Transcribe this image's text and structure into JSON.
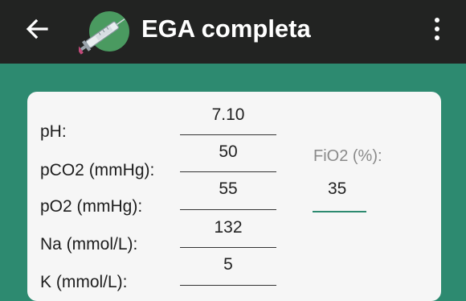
{
  "header": {
    "title": "EGA completa",
    "back_icon": "arrow-left-icon",
    "logo_icon": "syringe-icon",
    "menu_icon": "more-vert-icon"
  },
  "colors": {
    "appbar": "#222322",
    "accent": "#2d8a70",
    "card": "#f6f6f6"
  },
  "form": {
    "fields": [
      {
        "label": "pH:",
        "value": "7.10"
      },
      {
        "label": "pCO2 (mmHg):",
        "value": "50"
      },
      {
        "label": "pO2 (mmHg):",
        "value": "55"
      },
      {
        "label": "Na (mmol/L):",
        "value": "132"
      },
      {
        "label": "K (mmol/L):",
        "value": "5"
      }
    ],
    "fio2": {
      "label": "FiO2 (%):",
      "value": "35"
    }
  }
}
